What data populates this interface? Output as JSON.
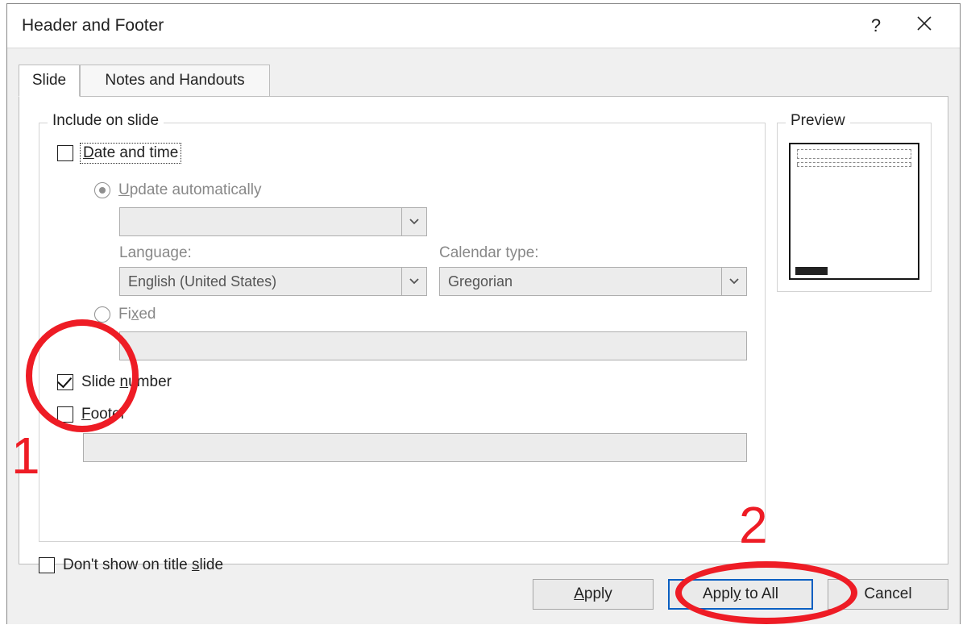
{
  "dialog": {
    "title": "Header and Footer",
    "help_symbol": "?"
  },
  "tabs": {
    "slide": "Slide",
    "notes": "Notes and Handouts"
  },
  "group": {
    "include_legend": "Include on slide",
    "preview_legend": "Preview"
  },
  "datetime": {
    "label_pre": "D",
    "label_post": "ate and time",
    "update_auto_pre": "U",
    "update_auto_post": "pdate automatically",
    "language_label_pre": "L",
    "language_label_post": "anguage:",
    "language_value": "English (United States)",
    "calendar_label_pre": "C",
    "calendar_label_post": "alendar type:",
    "calendar_value": "Gregorian",
    "fixed_pre": "Fi",
    "fixed_ul": "x",
    "fixed_post": "ed"
  },
  "slidenum": {
    "label_pre": "Slide ",
    "label_ul": "n",
    "label_post": "umber"
  },
  "footer": {
    "label_ul": "F",
    "label_post": "ooter"
  },
  "dont_show": {
    "pre": "Don't show on title ",
    "ul": "s",
    "post": "lide"
  },
  "buttons": {
    "apply_ul": "A",
    "apply_post": "pply",
    "apply_all_pre": "Appl",
    "apply_all_ul": "y",
    "apply_all_post": " to All",
    "cancel": "Cancel"
  },
  "annotations": {
    "one": "1",
    "two": "2"
  }
}
